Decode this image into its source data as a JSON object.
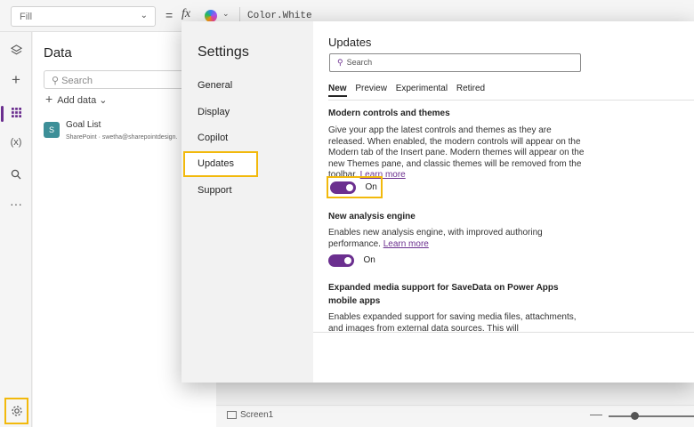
{
  "formula_bar": {
    "property": "Fill",
    "equals": "=",
    "fx": "fx",
    "formula": "Color.White"
  },
  "data_pane": {
    "title": "Data",
    "search_placeholder": "Search",
    "add_data": "Add data",
    "sources": [
      {
        "name": "Goal List",
        "subtitle": "SharePoint · swetha@sharepointdesign."
      }
    ]
  },
  "settings": {
    "title": "Settings",
    "nav": [
      "General",
      "Display",
      "Copilot",
      "Updates",
      "Support"
    ],
    "selected_nav": "Updates"
  },
  "updates": {
    "title": "Updates",
    "search_placeholder": "Search",
    "tabs": [
      "New",
      "Preview",
      "Experimental",
      "Retired"
    ],
    "active_tab": "New",
    "sections": [
      {
        "title": "Modern controls and themes",
        "description": "Give your app the latest controls and themes as they are released. When enabled, the modern controls will appear on the Modern tab of the Insert pane. Modern themes will appear on the new Themes pane, and classic themes will be removed from the toolbar.",
        "link": "Learn more",
        "toggle": "On"
      },
      {
        "title": "New analysis engine",
        "description": "Enables new analysis engine, with improved authoring performance.",
        "link": "Learn more",
        "toggle": "On"
      },
      {
        "title": "Expanded media support for SaveData on Power Apps mobile apps",
        "description": "Enables expanded support for saving media files, attachments, and images from external data sources. This will"
      }
    ]
  },
  "status_bar": {
    "screen": "Screen1"
  },
  "colors": {
    "accent": "#6b2f8f",
    "highlight": "#f2b90c"
  }
}
